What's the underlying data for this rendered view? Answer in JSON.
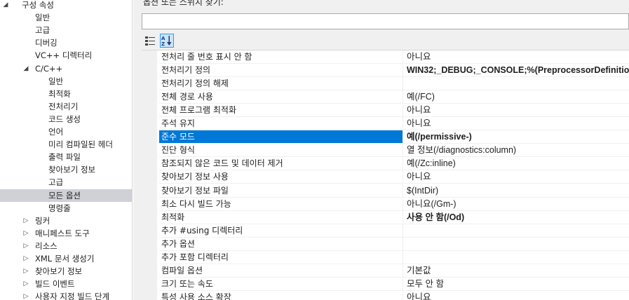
{
  "tree": {
    "items": [
      {
        "label": "구성 속성",
        "level": 0,
        "arrow": "◢",
        "selected": false
      },
      {
        "label": "일반",
        "level": 1,
        "arrow": "",
        "selected": false
      },
      {
        "label": "고급",
        "level": 1,
        "arrow": "",
        "selected": false
      },
      {
        "label": "디버깅",
        "level": 1,
        "arrow": "",
        "selected": false
      },
      {
        "label": "VC++ 디렉터리",
        "level": 1,
        "arrow": "",
        "selected": false
      },
      {
        "label": "C/C++",
        "level": 1,
        "arrow": "◢",
        "selected": false
      },
      {
        "label": "일반",
        "level": 2,
        "arrow": "",
        "selected": false
      },
      {
        "label": "최적화",
        "level": 2,
        "arrow": "",
        "selected": false
      },
      {
        "label": "전처리기",
        "level": 2,
        "arrow": "",
        "selected": false
      },
      {
        "label": "코드 생성",
        "level": 2,
        "arrow": "",
        "selected": false
      },
      {
        "label": "언어",
        "level": 2,
        "arrow": "",
        "selected": false
      },
      {
        "label": "미리 컴파일된 헤더",
        "level": 2,
        "arrow": "",
        "selected": false
      },
      {
        "label": "출력 파일",
        "level": 2,
        "arrow": "",
        "selected": false
      },
      {
        "label": "찾아보기 정보",
        "level": 2,
        "arrow": "",
        "selected": false
      },
      {
        "label": "고급",
        "level": 2,
        "arrow": "",
        "selected": false
      },
      {
        "label": "모든 옵션",
        "level": 2,
        "arrow": "",
        "selected": true
      },
      {
        "label": "명령줄",
        "level": 2,
        "arrow": "",
        "selected": false
      },
      {
        "label": "링커",
        "level": 1,
        "arrow": "▷",
        "selected": false
      },
      {
        "label": "매니페스트 도구",
        "level": 1,
        "arrow": "▷",
        "selected": false
      },
      {
        "label": "리소스",
        "level": 1,
        "arrow": "▷",
        "selected": false
      },
      {
        "label": "XML 문서 생성기",
        "level": 1,
        "arrow": "▷",
        "selected": false
      },
      {
        "label": "찾아보기 정보",
        "level": 1,
        "arrow": "▷",
        "selected": false
      },
      {
        "label": "빌드 이벤트",
        "level": 1,
        "arrow": "▷",
        "selected": false
      },
      {
        "label": "사용자 지정 빌드 단계",
        "level": 1,
        "arrow": "▷",
        "selected": false
      }
    ]
  },
  "search": {
    "label": "옵션 또는 스위치 찾기:",
    "value": "",
    "placeholder": ""
  },
  "toolbar": {
    "categorized_icon": "categorized-icon",
    "alphabetical_icon": "sort-alphabetical-icon"
  },
  "properties": [
    {
      "name": "전처리 줄 번호 표시 안 함",
      "value": "아니요",
      "bold": false,
      "selected": false
    },
    {
      "name": "전처리기 정의",
      "value": "WIN32;_DEBUG;_CONSOLE;%(PreprocessorDefinitions)",
      "bold": true,
      "selected": false
    },
    {
      "name": "전처리기 정의 해제",
      "value": "",
      "bold": false,
      "selected": false
    },
    {
      "name": "전체 경로 사용",
      "value": "예(/FC)",
      "bold": false,
      "selected": false
    },
    {
      "name": "전체 프로그램 최적화",
      "value": "아니요",
      "bold": false,
      "selected": false
    },
    {
      "name": "주석 유지",
      "value": "아니요",
      "bold": false,
      "selected": false
    },
    {
      "name": "준수 모드",
      "value": "예(/permissive-)",
      "bold": true,
      "selected": true
    },
    {
      "name": "진단 형식",
      "value": "열 정보(/diagnostics:column)",
      "bold": false,
      "selected": false
    },
    {
      "name": "참조되지 않은 코드 및 데이터 제거",
      "value": "예(/Zc:inline)",
      "bold": false,
      "selected": false
    },
    {
      "name": "찾아보기 정보 사용",
      "value": "아니요",
      "bold": false,
      "selected": false
    },
    {
      "name": "찾아보기 정보 파일",
      "value": "$(IntDir)",
      "bold": false,
      "selected": false
    },
    {
      "name": "최소 다시 빌드 가능",
      "value": "아니요(/Gm-)",
      "bold": false,
      "selected": false
    },
    {
      "name": "최적화",
      "value": "사용 안 함(/Od)",
      "bold": true,
      "selected": false
    },
    {
      "name": "추가 #using 디렉터리",
      "value": "",
      "bold": false,
      "selected": false
    },
    {
      "name": "추가 옵션",
      "value": "",
      "bold": false,
      "selected": false
    },
    {
      "name": "추가 포함 디렉터리",
      "value": "",
      "bold": false,
      "selected": false
    },
    {
      "name": "컴파일 옵션",
      "value": "기본값",
      "bold": false,
      "selected": false
    },
    {
      "name": "크기 또는 속도",
      "value": "모두 안 함",
      "bold": false,
      "selected": false
    },
    {
      "name": "특성 사용 소스 확장",
      "value": "아니요",
      "bold": false,
      "selected": false
    }
  ],
  "colors": {
    "selection_blue": "#0078d7",
    "tree_selected": "#cfd1d7",
    "panel_bg": "#f0f0f0"
  }
}
